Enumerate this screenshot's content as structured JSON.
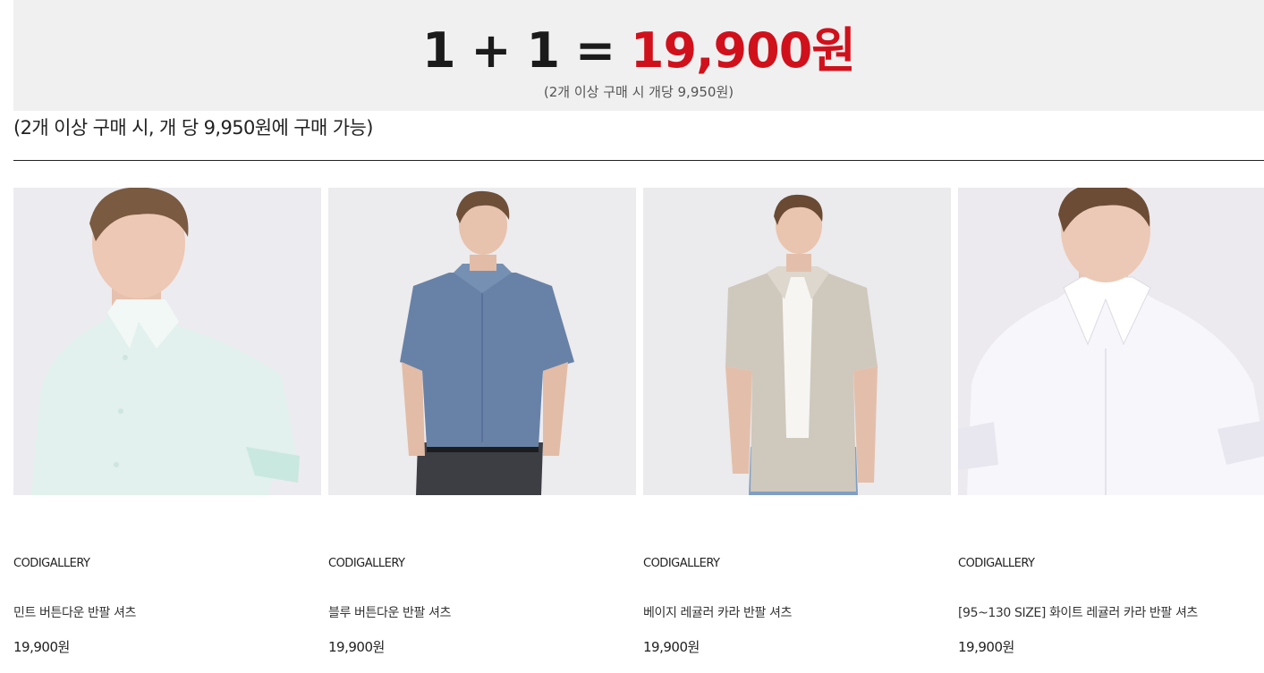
{
  "banner": {
    "formula": "1 + 1 = ",
    "price": "19,900원",
    "subtitle": "(2개 이상 구매 시 개당 9,950원)"
  },
  "notice": "(2개 이상 구매 시, 개 당 9,950원에 구매 가능)",
  "colors": {
    "accent_price": "#d0111b",
    "banner_background": "#f1f0f1",
    "product_image_background": "#ecebee"
  },
  "products": [
    {
      "brand": "CODIGALLERY",
      "name": "민트 버튼다운 반팔 셔츠",
      "price": "19,900원",
      "image": "model-mint-buttondown-shirt",
      "shirt_color": "#dff0ec"
    },
    {
      "brand": "CODIGALLERY",
      "name": "블루 버튼다운 반팔 셔츠",
      "price": "19,900원",
      "image": "model-blue-buttondown-shirt",
      "shirt_color": "#6a84a8"
    },
    {
      "brand": "CODIGALLERY",
      "name": "베이지 레귤러 카라 반팔 셔츠",
      "price": "19,900원",
      "image": "model-beige-regular-collar-shirt",
      "shirt_color": "#cfc9be"
    },
    {
      "brand": "CODIGALLERY",
      "name": "[95~130 SIZE] 화이트 레귤러 카라 반팔 셔츠",
      "price": "19,900원",
      "image": "model-white-regular-collar-shirt",
      "shirt_color": "#f6f5fa"
    }
  ]
}
